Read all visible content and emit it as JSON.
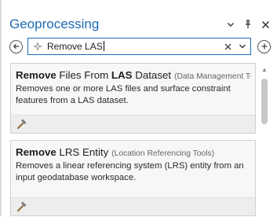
{
  "pane": {
    "title": "Geoprocessing",
    "controls": {
      "options_icon": "chevron-down-icon",
      "pin_icon": "pin-icon",
      "close_icon": "close-icon"
    }
  },
  "search": {
    "value": "Remove LAS",
    "back_icon": "back-arrow-icon",
    "add_icon": "plus-circle-icon"
  },
  "results": [
    {
      "title_bold_1": "Remove",
      "title_mid_1": " Files From ",
      "title_bold_2": "LAS",
      "title_mid_2": " Dataset",
      "toolbox": "(Data Management To...",
      "description": "Removes one or more LAS files and surface constraint features from a LAS dataset.",
      "icon": "hammer-icon"
    },
    {
      "title_bold_1": "Remove",
      "title_mid_1": " LRS Entity",
      "toolbox": "(Location Referencing Tools)",
      "description": "Removes a linear referencing system (LRS) entity from an input geodatabase workspace.",
      "icon": "hammer-icon"
    }
  ],
  "colors": {
    "accent": "#1b6bb3",
    "card_bg": "#f7f7f7"
  }
}
